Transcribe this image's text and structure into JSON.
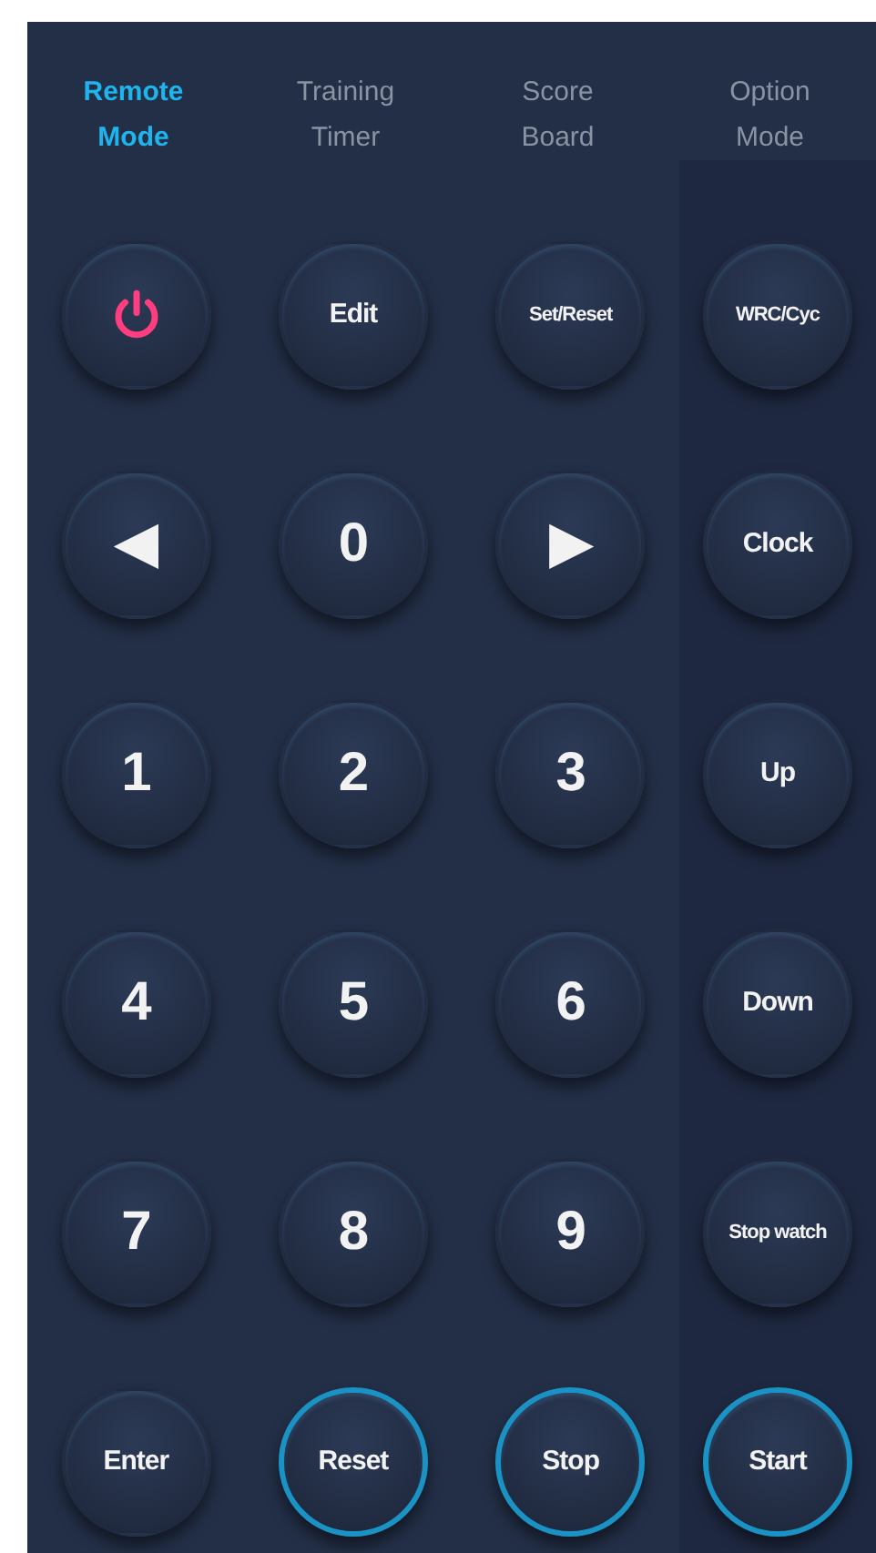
{
  "tabs": [
    {
      "label": "Remote Mode",
      "selected": true
    },
    {
      "label": "Training Timer",
      "selected": false
    },
    {
      "label": "Score Board",
      "selected": false
    },
    {
      "label": "Option Mode",
      "selected": false
    }
  ],
  "keypad": [
    {
      "kind": "power",
      "ring": false
    },
    {
      "kind": "text",
      "label": "Edit",
      "ring": false
    },
    {
      "kind": "text",
      "label": "Set/Reset",
      "ring": false
    },
    {
      "kind": "text",
      "label": "◀",
      "ring": false
    },
    {
      "kind": "text",
      "label": "0",
      "ring": false
    },
    {
      "kind": "text",
      "label": "▶",
      "ring": false
    },
    {
      "kind": "text",
      "label": "1",
      "ring": false
    },
    {
      "kind": "text",
      "label": "2",
      "ring": false
    },
    {
      "kind": "text",
      "label": "3",
      "ring": false
    },
    {
      "kind": "text",
      "label": "4",
      "ring": false
    },
    {
      "kind": "text",
      "label": "5",
      "ring": false
    },
    {
      "kind": "text",
      "label": "6",
      "ring": false
    },
    {
      "kind": "text",
      "label": "7",
      "ring": false
    },
    {
      "kind": "text",
      "label": "8",
      "ring": false
    },
    {
      "kind": "text",
      "label": "9",
      "ring": false
    },
    {
      "kind": "text",
      "label": "Enter",
      "ring": false
    },
    {
      "kind": "text",
      "label": "Reset",
      "ring": true
    },
    {
      "kind": "text",
      "label": "Stop",
      "ring": true
    }
  ],
  "side_keys": [
    {
      "kind": "text",
      "label": "WRC/Cyc",
      "ring": false
    },
    {
      "kind": "text",
      "label": "Clock",
      "ring": false
    },
    {
      "kind": "text",
      "label": "Up",
      "ring": false
    },
    {
      "kind": "text",
      "label": "Down",
      "ring": false
    },
    {
      "kind": "text",
      "label": "Stop watch",
      "ring": false
    },
    {
      "kind": "text",
      "label": "Start",
      "ring": true
    }
  ]
}
